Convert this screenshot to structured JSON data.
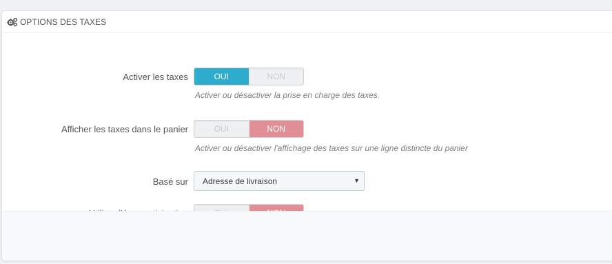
{
  "panel": {
    "title": "OPTIONS DES TAXES",
    "icon": "cogs-icon"
  },
  "fields": {
    "enable_taxes": {
      "label": "Activer les taxes",
      "yes": "OUI",
      "no": "NON",
      "selected": "yes",
      "help": "Activer ou désactiver la prise en charge des taxes."
    },
    "display_in_cart": {
      "label": "Afficher les taxes dans le panier",
      "yes": "OUI",
      "no": "NON",
      "selected": "no",
      "help": "Activer ou désactiver l'affichage des taxes sur une ligne distincte du panier"
    },
    "based_on": {
      "label": "Basé sur",
      "value": "Adresse de livraison"
    },
    "eco_tax": {
      "label": "Utiliser l'éco-participation",
      "yes": "OUI",
      "no": "NON",
      "selected": "no"
    }
  },
  "colors": {
    "yes_active": "#2eacce",
    "no_active": "#e08f95"
  }
}
